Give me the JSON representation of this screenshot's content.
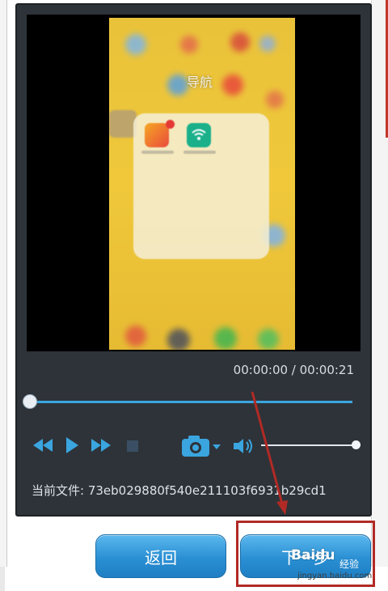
{
  "phone": {
    "title": "导航"
  },
  "player": {
    "time": "00:00:00 / 00:00:21",
    "file_label": "当前文件: ",
    "file_name": "73eb029880f540e211103f6931b29cd1",
    "seek_progress": 0.0,
    "volume_level": 1.0
  },
  "buttons": {
    "back_label": "返回",
    "download_label": "下一步"
  },
  "watermark": {
    "brand": "Baidu",
    "sub": "经验",
    "url": "jingyan.baidu.com"
  },
  "icons": {
    "rewind": "rewind-icon",
    "play": "play-icon",
    "forward": "fast-forward-icon",
    "stop": "stop-icon",
    "camera": "camera-icon",
    "volume": "volume-icon"
  },
  "colors": {
    "accent": "#3aa5df",
    "player_bg": "#2e3339",
    "button": "#2a8fd3",
    "highlight": "#b12a25"
  }
}
